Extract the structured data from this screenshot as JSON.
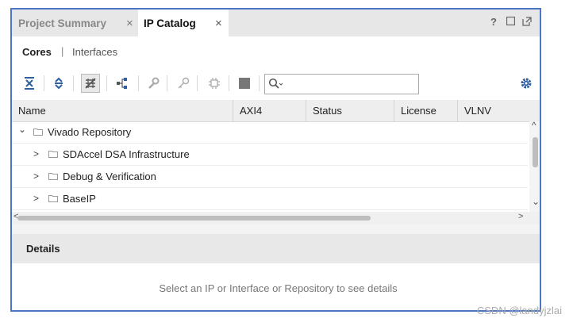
{
  "tabs": [
    {
      "label": "Project Summary",
      "close": "×"
    },
    {
      "label": "IP Catalog",
      "close": "×"
    }
  ],
  "window_controls": [
    "?",
    "□",
    "⧉"
  ],
  "subnav": {
    "cores": "Cores",
    "separator": "|",
    "interfaces": "Interfaces"
  },
  "toolbar": {
    "icons": [
      "collapse-all-icon",
      "expand-all-icon",
      "filter-icon",
      "hierarchy-icon",
      "wrench-icon",
      "key-icon",
      "chip-icon",
      "stop-icon",
      "gear-icon"
    ],
    "search_placeholder": ""
  },
  "table": {
    "columns": [
      "Name",
      "AXI4",
      "Status",
      "License",
      "VLNV"
    ],
    "rows": [
      {
        "label": "Vivado Repository",
        "expander": "⌄",
        "level": 0
      },
      {
        "label": "SDAccel DSA Infrastructure",
        "expander": ">",
        "level": 1
      },
      {
        "label": "Debug & Verification",
        "expander": ">",
        "level": 1
      },
      {
        "label": "BaseIP",
        "expander": ">",
        "level": 1
      }
    ]
  },
  "scroll_arrows": {
    "up": "^",
    "down": "⌄",
    "left": "<",
    "right": ">"
  },
  "details": {
    "title": "Details",
    "message": "Select an IP or Interface or Repository to see details"
  },
  "watermark": "CSDN @landyjzlai",
  "colors": {
    "frame_border": "#4a77c4",
    "header_bg": "#e7e7e7",
    "accent_gear": "#2c5fa0"
  }
}
